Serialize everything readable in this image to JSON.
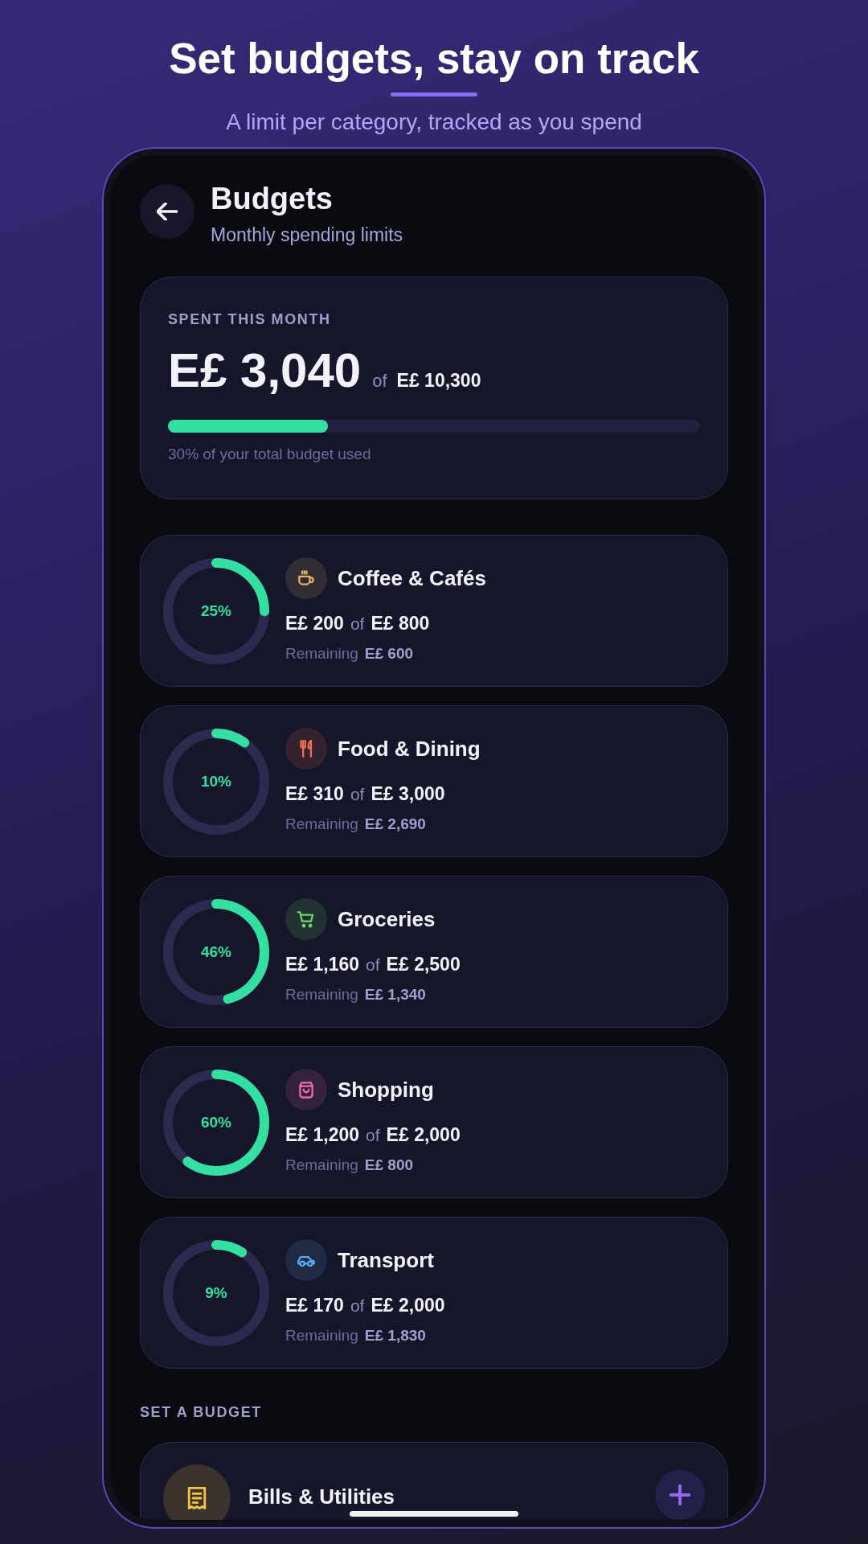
{
  "header": {
    "title": "Set budgets, stay on track",
    "subtitle": "A limit per category, tracked as you spend"
  },
  "screen": {
    "title": "Budgets",
    "subtitle": "Monthly spending limits"
  },
  "summary": {
    "label": "SPENT THIS MONTH",
    "spent": "E£ 3,040",
    "of": "of",
    "total": "E£ 10,300",
    "level": 0.3,
    "caption": "30% of your total budget used"
  },
  "categories": [
    {
      "kind": "coffee",
      "name": "Coffee & Cafés",
      "color": "#e3b271",
      "percent": "25%",
      "level": 0.25,
      "spent": "E£ 200",
      "of": "of",
      "limit": "E£ 800",
      "remaining_label": "Remaining",
      "remaining": "E£ 600"
    },
    {
      "kind": "dining",
      "name": "Food & Dining",
      "color": "#f2704f",
      "percent": "10%",
      "level": 0.1,
      "spent": "E£ 310",
      "of": "of",
      "limit": "E£ 3,000",
      "remaining_label": "Remaining",
      "remaining": "E£ 2,690"
    },
    {
      "kind": "groceries",
      "name": "Groceries",
      "color": "#6fd46a",
      "percent": "46%",
      "level": 0.46,
      "spent": "E£ 1,160",
      "of": "of",
      "limit": "E£ 2,500",
      "remaining_label": "Remaining",
      "remaining": "E£ 1,340"
    },
    {
      "kind": "shopping",
      "name": "Shopping",
      "color": "#f06bb4",
      "percent": "60%",
      "level": 0.6,
      "spent": "E£ 1,200",
      "of": "of",
      "limit": "E£ 2,000",
      "remaining_label": "Remaining",
      "remaining": "E£ 800"
    },
    {
      "kind": "transport",
      "name": "Transport",
      "color": "#5fa6f2",
      "percent": "9%",
      "level": 0.09,
      "spent": "E£ 170",
      "of": "of",
      "limit": "E£ 2,000",
      "remaining_label": "Remaining",
      "remaining": "E£ 1,830"
    }
  ],
  "set_budget": {
    "heading": "SET A BUDGET",
    "items": [
      {
        "kind": "bills",
        "name": "Bills & Utilities",
        "color": "#f5c542"
      }
    ]
  }
}
